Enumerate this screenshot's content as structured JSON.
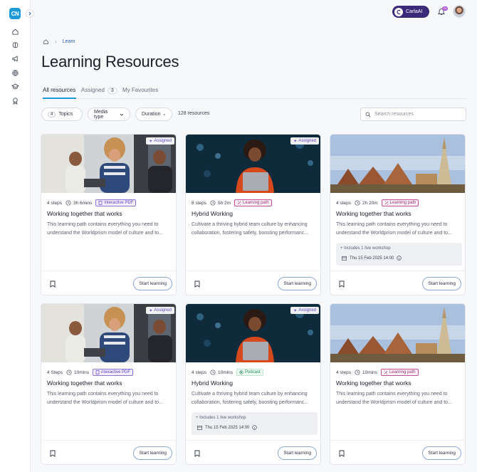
{
  "sidebar": {
    "logo": "CN",
    "items": [
      {
        "icon": "home-icon"
      },
      {
        "icon": "brain-icon"
      },
      {
        "icon": "megaphone-icon"
      },
      {
        "icon": "globe-icon"
      },
      {
        "icon": "graduation-cap-icon"
      },
      {
        "icon": "award-icon"
      }
    ]
  },
  "header": {
    "ai_label": "CarlaAI",
    "notification_count": "10"
  },
  "breadcrumb": {
    "current": "Learn"
  },
  "page": {
    "title": "Learning Resources"
  },
  "tabs": [
    {
      "label": "All resources",
      "active": true
    },
    {
      "label": "Assigned",
      "count": "3"
    },
    {
      "label": "My Favourites"
    }
  ],
  "filters": {
    "topics_count": "4",
    "topics_label": "Topics",
    "media_label": "Media type",
    "duration_label": "Duration",
    "result_count": "128 resources",
    "search_placeholder": "Search resources"
  },
  "cards": [
    {
      "assigned": "Assigned",
      "steps": "4 steps",
      "duration": "3h 6mins",
      "tag": "interactive PDF",
      "title": "Working together that works",
      "desc1": "This learning path contains everything you need to",
      "desc2": "understand the Worldprism model of culture and to..."
    },
    {
      "assigned": "Assigned",
      "steps": "8 steps",
      "duration": "5h 2m",
      "tag": "Learning path",
      "title": "Hybrid Working",
      "desc1": "Cultivate a thriving hybrid team culture by enhancing",
      "desc2": "collaboration, fostering safety, boosting performanc..."
    },
    {
      "steps": "4 steps",
      "duration": "2h 20m",
      "tag": "Learning path",
      "title": "Working together that works",
      "desc1": "This learning path contains everything you need to",
      "desc2": "understand the Worldprism model of culture and to...",
      "workshop": "+ Includes 1 live workshop",
      "workshop_date": "Thu 15 Feb 2025 14:00"
    },
    {
      "assigned": "Assigned",
      "steps": "4 Steps",
      "duration": "10mins",
      "tag": "interactive PDF",
      "title": "Working together that works",
      "desc1": "This learning path contains everything you need to",
      "desc2": "understand the Worldprism model of culture and to..."
    },
    {
      "assigned": "Assigned",
      "steps": "4 steps",
      "duration": "10mins",
      "tag": "Podcast",
      "title": "Hybrid Working",
      "desc1": "Cultivate a thriving hybrid team culture by enhancing",
      "desc2": "collaboration, fostering safety, boosting performanc...",
      "workshop": "+ Includes 1 live workshop",
      "workshop_date": "Thu 15 Feb 2025 14:00"
    },
    {
      "steps": "4 steps",
      "duration": "10mins",
      "tag": "Learning path",
      "title": "Working together that works",
      "desc1": "This learning path contains everything you need to",
      "desc2": "understand the Worldprism model of culture and to..."
    }
  ],
  "start_label": "Start learning",
  "colors": {
    "brand": "#1e9bd7",
    "ai": "#3b2a79",
    "assigned": "#6b4ec5"
  }
}
